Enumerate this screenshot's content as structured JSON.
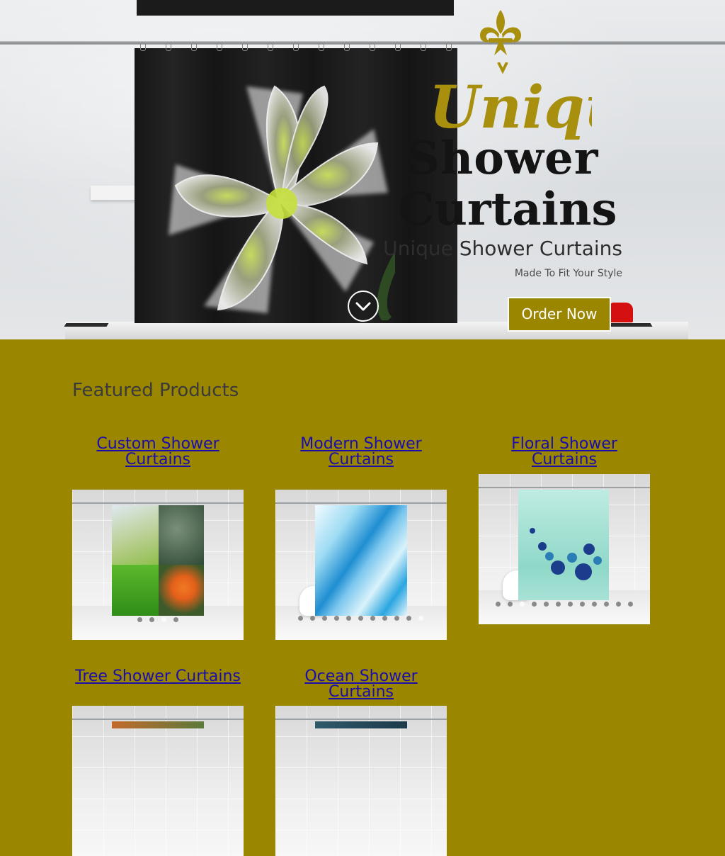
{
  "hero": {
    "brand_top": "Unique",
    "brand_line1": "Shower",
    "brand_line2": "Curtains",
    "title": "Unique Shower Curtains",
    "subtitle": "Made To Fit Your Style",
    "order_button": "Order Now",
    "scroll_icon": "chevron-down-circle-icon",
    "accent_color": "#9b8600"
  },
  "featured": {
    "title": "Featured Products",
    "products": [
      {
        "label": "Custom Shower Curtains",
        "dots": 4,
        "active_dot": 2
      },
      {
        "label": "Modern Shower Curtains",
        "dots": 11,
        "active_dot": 10
      },
      {
        "label": "Floral Shower Curtains",
        "dots": 12,
        "active_dot": 2
      },
      {
        "label": "Tree Shower Curtains"
      },
      {
        "label": "Ocean Shower Curtains"
      }
    ]
  },
  "colors": {
    "background": "#9b8600",
    "link": "#1a0dab",
    "heading": "#3a3a3a"
  }
}
